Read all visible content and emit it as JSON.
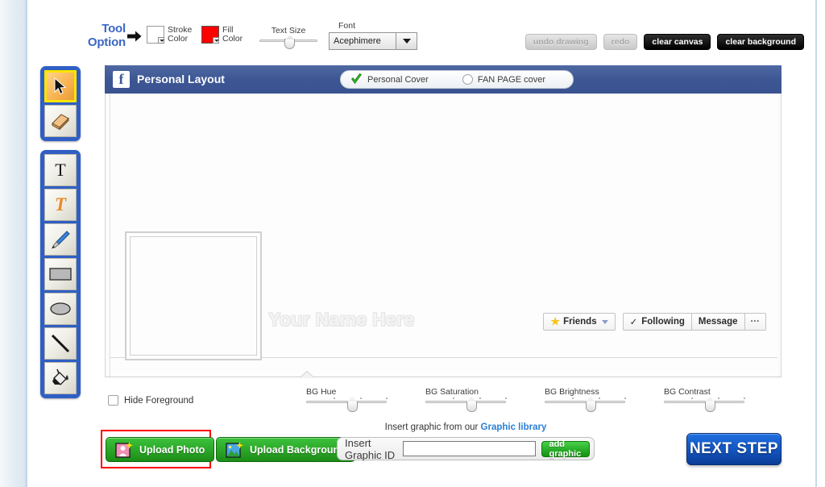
{
  "toolbar": {
    "tool_option_line1": "Tool",
    "tool_option_line2": "Option",
    "stroke_color_line1": "Stroke",
    "stroke_color_line2": "Color",
    "stroke_color_hex": "#ffffff",
    "fill_color_line1": "Fill",
    "fill_color_line2": "Color",
    "fill_color_hex": "#ff0000",
    "text_size_label": "Text Size",
    "font_label": "Font",
    "font_value": "Acephimere",
    "undo_label": "undo drawing",
    "redo_label": "redo",
    "clear_canvas_label": "clear canvas",
    "clear_background_label": "clear background"
  },
  "palette": {
    "group_one": [
      {
        "name": "select-cursor-tool",
        "active": true
      },
      {
        "name": "eraser-tool",
        "active": false
      }
    ],
    "group_two": [
      {
        "name": "text-tool",
        "active": false
      },
      {
        "name": "fancy-text-tool",
        "active": false
      },
      {
        "name": "brush-tool",
        "active": false
      },
      {
        "name": "rectangle-tool",
        "active": false
      },
      {
        "name": "ellipse-tool",
        "active": false
      },
      {
        "name": "line-tool",
        "active": false
      },
      {
        "name": "paint-bucket-tool",
        "active": false
      }
    ]
  },
  "cover": {
    "title": "Personal Layout",
    "logo_letter": "f",
    "toggle_personal": "Personal Cover",
    "toggle_fanpage": "FAN PAGE cover",
    "selected_toggle": "Personal Cover",
    "name_placeholder": "Your Name Here",
    "actions": {
      "friends": "Friends",
      "following": "Following",
      "message": "Message",
      "more": "···"
    }
  },
  "controls": {
    "hide_foreground_label": "Hide Foreground",
    "sliders": [
      {
        "label": "BG Hue",
        "value": 50
      },
      {
        "label": "BG Saturation",
        "value": 50
      },
      {
        "label": "BG Brightness",
        "value": 50
      },
      {
        "label": "BG Contrast",
        "value": 50
      }
    ]
  },
  "bottom": {
    "upload_photo_label": "Upload  Photo",
    "upload_background_label": "Upload Background",
    "graphic_caption_prefix": "Insert graphic from our ",
    "graphic_library_link": "Graphic library",
    "insert_graphic_id_label": "Insert Graphic ID",
    "insert_graphic_id_value": "",
    "insert_graphic_id_placeholder": "",
    "add_graphic_label": "add graphic",
    "next_step_label": "NEXT STEP"
  },
  "colors": {
    "accent_blue": "#3a67c4",
    "facebook_blue": "#3d5694",
    "green_button": "#2faa2b",
    "next_step_blue": "#1559c6",
    "highlight_red": "#ff0000",
    "active_tool_yellow": "#ffe400"
  }
}
